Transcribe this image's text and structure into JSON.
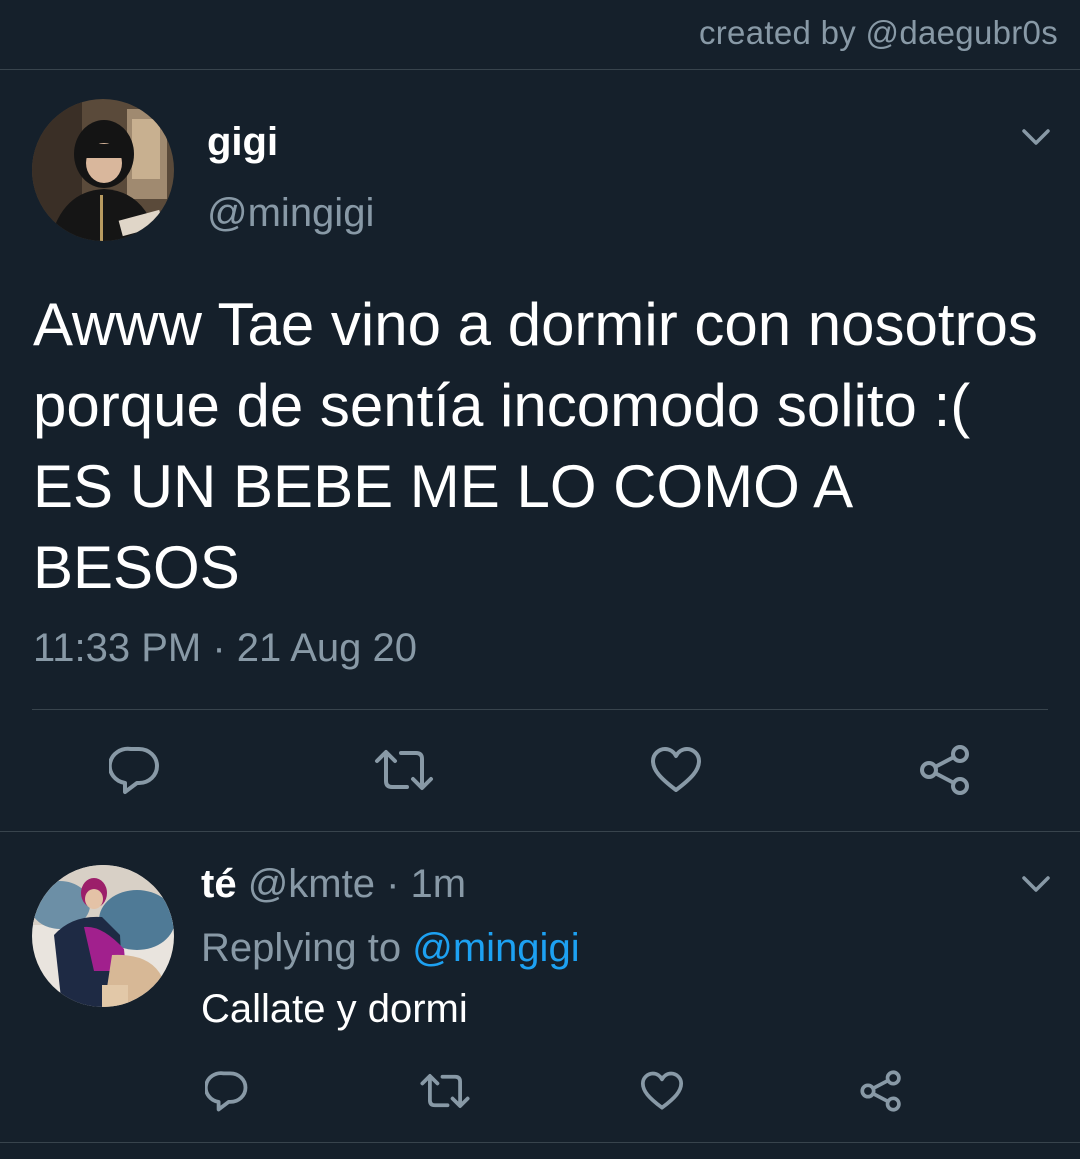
{
  "credit": "created by @daegubr0s",
  "main_tweet": {
    "display_name": "gigi",
    "handle": "@mingigi",
    "text": "Awww Tae vino a dormir con nosotros porque de sentía incomodo solito :( ES UN BEBE ME LO COMO A BESOS",
    "timestamp": "11:33 PM · 21 Aug 20",
    "actions": [
      "reply-icon",
      "retweet-icon",
      "like-icon",
      "share-icon"
    ]
  },
  "reply_tweet": {
    "display_name": "té",
    "handle": "@kmte",
    "time": "· 1m",
    "replying_label": "Replying to",
    "replying_to": "@mingigi",
    "text": "Callate y dormi",
    "actions": [
      "reply-icon",
      "retweet-icon",
      "like-icon",
      "share-icon"
    ]
  },
  "colors": {
    "background": "#15202b",
    "secondary_text": "#8899a6",
    "accent": "#1da1f2",
    "divider": "#38444d"
  }
}
